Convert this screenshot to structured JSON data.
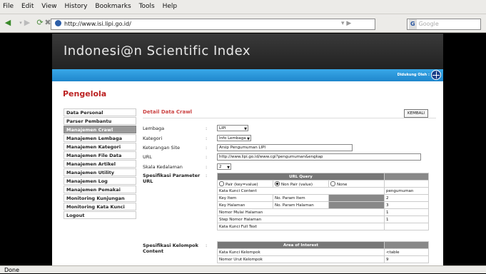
{
  "browser": {
    "menus": [
      "File",
      "Edit",
      "View",
      "History",
      "Bookmarks",
      "Tools",
      "Help"
    ],
    "url": "http://www.isi.lipi.go.id/",
    "search_placeholder": "Google",
    "status": "Done"
  },
  "site": {
    "title": "Indonesi@n Scientific Index",
    "supported_by": "Didukung Oleh :",
    "section_title": "Pengelola"
  },
  "sidebar": {
    "items": [
      {
        "label": "Data Personal"
      },
      {
        "label": "Parser Pembantu"
      },
      {
        "label": "Manajemen Crawl"
      },
      {
        "label": "Manajemen Lembaga"
      },
      {
        "label": "Manajemen Kategori"
      },
      {
        "label": "Manajemen File Data"
      },
      {
        "label": "Manajemen Artikel"
      },
      {
        "label": "Manajemen Utility"
      },
      {
        "label": "Manajemen Log"
      },
      {
        "label": "Manajemen Pemakai"
      },
      {
        "label": "Monitoring Kunjungan"
      },
      {
        "label": "Monitoring Kata Kunci"
      },
      {
        "label": "Logout"
      }
    ],
    "active": "Manajemen Crawl"
  },
  "form": {
    "title": "Detail Data Crawl",
    "back_label": "KEMBALI",
    "colon": ":",
    "lembaga": {
      "label": "Lembaga",
      "value": "LIPI"
    },
    "kategori": {
      "label": "Kategori",
      "value": "Info Lembaga"
    },
    "keterangan": {
      "label": "Keterangan Site",
      "value": "Arsip Pengumuman LIPI"
    },
    "url": {
      "label": "URL",
      "value": "http://www.lipi.go.id/www.cgi?pengumuman&engkap"
    },
    "skala": {
      "label": "Skala Kedalaman",
      "value": "2"
    },
    "spek_param": {
      "label": "Spesifikasi Parameter URL"
    },
    "spek_kelompok": {
      "label": "Spesifikasi Kelompok Content"
    }
  },
  "url_query": {
    "title": "URL Query",
    "radio_pair": "Pair (key=value)",
    "radio_nonpair": "Non Pair (value)",
    "radio_none": "None",
    "kata_kunci_content": {
      "label": "Kata Kunci Content",
      "value": "pengumuman"
    },
    "key_item": {
      "label": "Key Item",
      "sub": "No. Param Item",
      "value": "2"
    },
    "key_halaman": {
      "label": "Key Halaman",
      "sub": "No. Param Halaman",
      "value": "3"
    },
    "nomor_mulai": {
      "label": "Nomor Mulai Halaman",
      "value": "1"
    },
    "step_nomor": {
      "label": "Step Nomor Halaman",
      "value": "1"
    },
    "kata_kunci_full": {
      "label": "Kata Kunci Full Text",
      "value": ""
    }
  },
  "area_interest": {
    "title": "Area of Interest",
    "kata_kunci_kelompok": {
      "label": "Kata Kunci Kelompok",
      "value": "<table"
    },
    "nomor_urut_kelompok": {
      "label": "Nomor Urut Kelompok",
      "value": "9"
    }
  }
}
